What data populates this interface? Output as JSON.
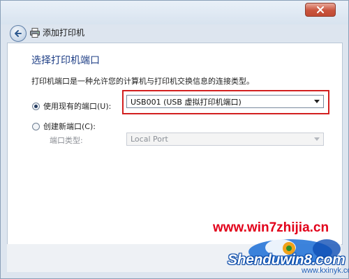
{
  "window": {
    "title": "添加打印机",
    "close_icon": "close-icon",
    "back_icon": "back-arrow-icon",
    "printer_icon": "printer-icon"
  },
  "page": {
    "heading": "选择打印机端口",
    "description": "打印机端口是一种允许您的计算机与打印机交换信息的连接类型。"
  },
  "options": {
    "existing_port": {
      "label": "使用现有的端口(U):",
      "selected": true,
      "value": "USB001 (USB 虚拟打印机端口)"
    },
    "new_port": {
      "label": "创建新端口(C):",
      "selected": false,
      "type_label": "端口类型:",
      "type_value": "Local Port"
    }
  },
  "colors": {
    "highlight_border": "#d21f1f",
    "heading": "#1f3f86",
    "close_button": "#c9543d"
  },
  "watermark": {
    "url": "www.win7zhijia.cn",
    "brand": "Shenduwin8.com",
    "url2": "www.kxinyk.com"
  }
}
